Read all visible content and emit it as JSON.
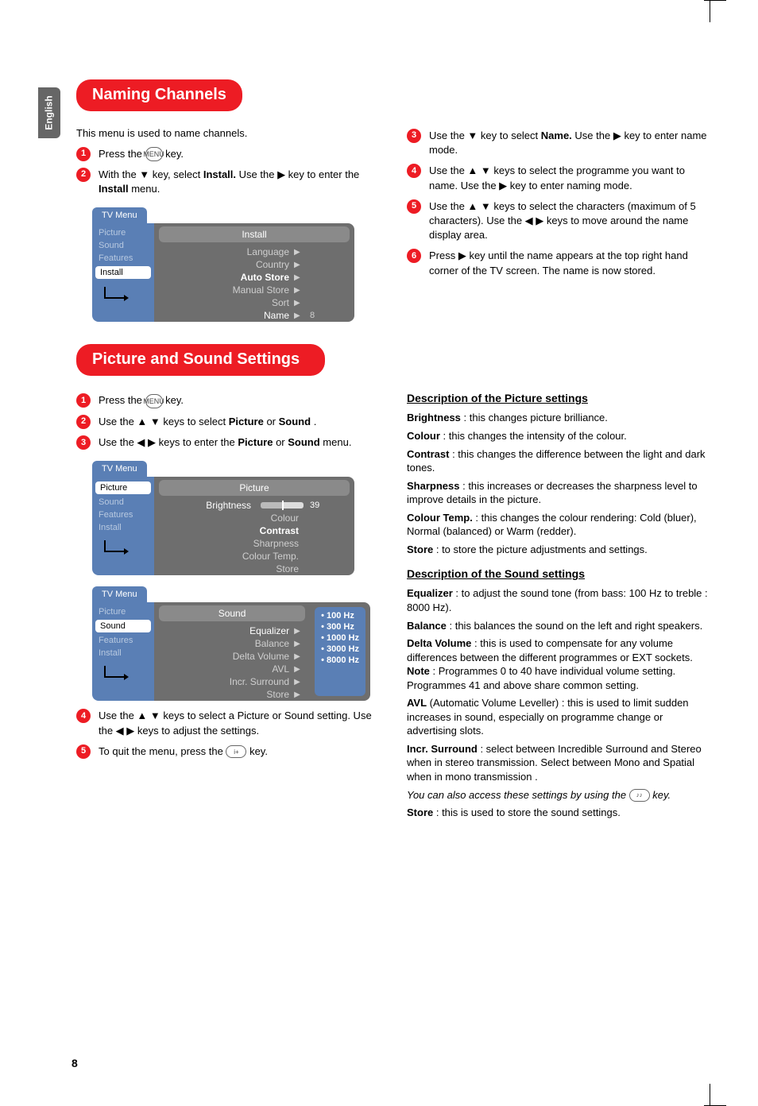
{
  "lang_tab": "English",
  "headings": {
    "naming": "Naming Channels",
    "picsound": "Picture and Sound Settings"
  },
  "naming": {
    "intro": "This menu is used to name channels.",
    "step1_pre": "Press the ",
    "step1_post": " key.",
    "menu_key": "MENU",
    "step2_a": "With the ▼ key, select ",
    "step2_b": "Install.",
    "step2_c": " Use the ▶ key to enter the ",
    "step2_d": "Install",
    "step2_e": " menu.",
    "step3_a": "Use the ▼ key to select ",
    "step3_b": "Name.",
    "step3_c": " Use the ▶ key to enter name mode.",
    "step4": "Use the ▲ ▼ keys to select the programme you want to name. Use the ▶ key to enter naming mode.",
    "step5": "Use the ▲ ▼ keys to select the characters (maximum of 5 characters). Use the ◀  ▶ keys to move around the name display area.",
    "step6": "Press  ▶ key until the name appears at the top right hand corner of the TV screen. The name is now stored."
  },
  "menu_install": {
    "tab": "TV Menu",
    "side": [
      "Picture",
      "Sound",
      "Features"
    ],
    "side_sel": "Install",
    "title": "Install",
    "items": [
      "Language",
      "Country",
      "Auto Store",
      "Manual Store",
      "Sort",
      "Name"
    ],
    "val_name": "8"
  },
  "picsound": {
    "step1_pre": "Press the ",
    "step1_key": "MENU",
    "step1_post": " key.",
    "step2_a": "Use the ▲ ▼ keys to select ",
    "step2_b": "Picture",
    "step2_c": " or ",
    "step2_d": "Sound",
    "step2_e": ".",
    "step3_a": "Use the  ◀  ▶  keys to enter the ",
    "step3_b": "Picture",
    "step3_c": " or ",
    "step3_d": "Sound",
    "step3_e": " menu.",
    "step4": "Use the ▲ ▼ keys to select a Picture or Sound setting. Use the ◀  ▶ keys to adjust the settings.",
    "step5_pre": "To quit the menu, press the ",
    "step5_key": "i+",
    "step5_post": " key."
  },
  "menu_picture": {
    "tab": "TV Menu",
    "side_sel": "Picture",
    "side": [
      "Sound",
      "Features",
      "Install"
    ],
    "title": "Picture",
    "items": [
      "Brightness",
      "Colour",
      "Contrast",
      "Sharpness",
      "Colour Temp.",
      "Store"
    ],
    "brightness_val": "39"
  },
  "menu_sound": {
    "tab": "TV Menu",
    "side": [
      "Picture"
    ],
    "side_sel": "Sound",
    "side2": [
      "Features",
      "Install"
    ],
    "title": "Sound",
    "items": [
      "Equalizer",
      "Balance",
      "Delta Volume",
      "AVL",
      "Incr. Surround",
      "Store"
    ],
    "eq": [
      "•  100 Hz",
      "•  300 Hz",
      "•  1000 Hz",
      "•  3000 Hz",
      "•  8000 Hz"
    ]
  },
  "desc_picture": {
    "head": "Description of the Picture settings",
    "brightness": " : this changes picture brilliance.",
    "brightness_l": "Brightness",
    "colour": " : this changes the intensity of the colour.",
    "colour_l": "Colour",
    "contrast": " : this changes the difference between the light and dark tones.",
    "contrast_l": "Contrast",
    "sharpness": " : this increases or decreases the sharpness level to improve details in the picture.",
    "sharpness_l": "Sharpness",
    "ct": " : this changes the colour rendering: Cold (bluer), Normal (balanced) or Warm (redder).",
    "ct_l": "Colour Temp.",
    "store": " : to store the picture adjustments and settings.",
    "store_l": "Store"
  },
  "desc_sound": {
    "head": "Description of the Sound settings",
    "eq": " : to adjust the sound tone (from bass: 100 Hz to treble : 8000 Hz).",
    "eq_l": "Equalizer",
    "bal": " : this balances the sound on the left and right speakers.",
    "bal_l": "Balance",
    "dv_a": " : this is used to compensate for any volume differences between the different programmes or EXT sockets. ",
    "dv_b": "Note",
    "dv_c": " : Programmes 0 to 40 have individual volume setting. Programmes 41 and above share common setting.",
    "dv_l": "Delta Volume",
    "avl": " (Automatic Volume Leveller) : this is used to limit sudden increases in sound, especially on programme change or advertising slots.",
    "avl_l": "AVL",
    "is": " : select between Incredible Surround and Stereo when in stereo transmission. Select between Mono and Spatial when in mono transmission .",
    "is_l": "Incr. Surround",
    "italic_a": "You can also access these settings by using the ",
    "italic_key": "♪♪",
    "italic_b": " key.",
    "store": " : this is used to store the sound settings.",
    "store_l": "Store"
  },
  "page_num": "8"
}
